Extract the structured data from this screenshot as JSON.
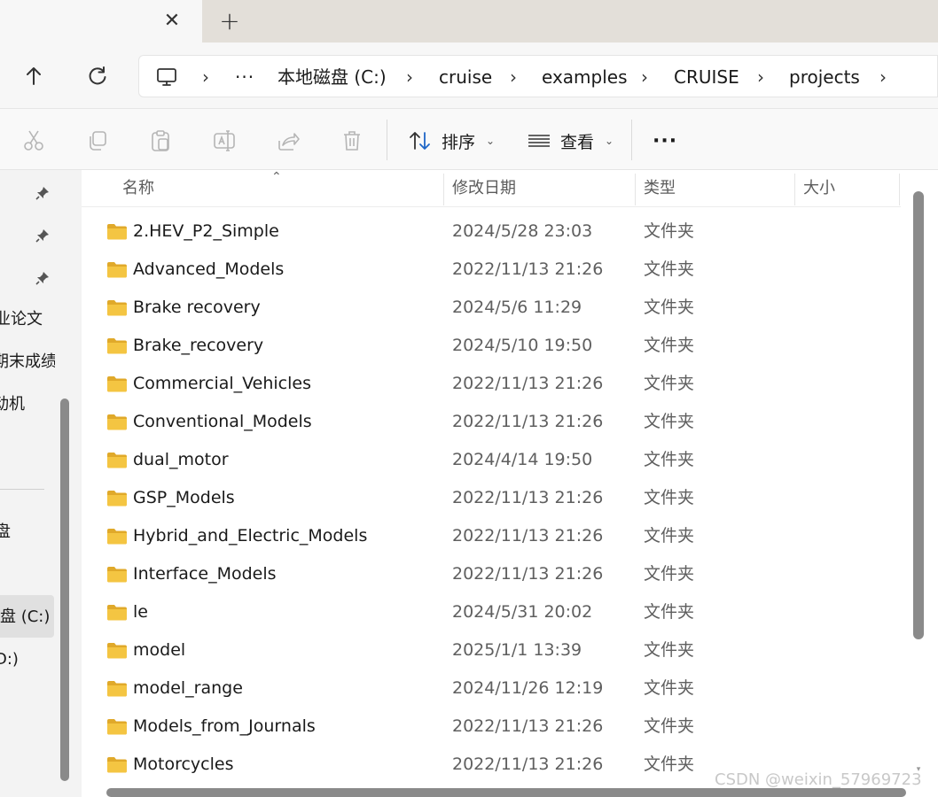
{
  "tab": {
    "close_glyph": "✕",
    "new_glyph": "+"
  },
  "nav": {
    "up_icon": "up-arrow-icon",
    "refresh_icon": "refresh-icon"
  },
  "address": {
    "more": "···",
    "crumbs": [
      "本地磁盘 (C:)",
      "cruise",
      "examples",
      "CRUISE",
      "projects"
    ],
    "separator": "›"
  },
  "toolbar": {
    "sort_label": "排序",
    "view_label": "查看",
    "more": "···"
  },
  "sidebar": {
    "items": [
      "业论文",
      "期末成绩",
      "动机",
      "盘",
      "盘 (C:)",
      "D:)"
    ]
  },
  "columns": {
    "name": "名称",
    "modified": "修改日期",
    "type": "类型",
    "size": "大小"
  },
  "files": [
    {
      "name": "2.HEV_P2_Simple",
      "date": "2024/5/28 23:03",
      "type": "文件夹"
    },
    {
      "name": "Advanced_Models",
      "date": "2022/11/13 21:26",
      "type": "文件夹"
    },
    {
      "name": "Brake recovery",
      "date": "2024/5/6 11:29",
      "type": "文件夹"
    },
    {
      "name": "Brake_recovery",
      "date": "2024/5/10 19:50",
      "type": "文件夹"
    },
    {
      "name": "Commercial_Vehicles",
      "date": "2022/11/13 21:26",
      "type": "文件夹"
    },
    {
      "name": "Conventional_Models",
      "date": "2022/11/13 21:26",
      "type": "文件夹"
    },
    {
      "name": "dual_motor",
      "date": "2024/4/14 19:50",
      "type": "文件夹"
    },
    {
      "name": "GSP_Models",
      "date": "2022/11/13 21:26",
      "type": "文件夹"
    },
    {
      "name": "Hybrid_and_Electric_Models",
      "date": "2022/11/13 21:26",
      "type": "文件夹"
    },
    {
      "name": "Interface_Models",
      "date": "2022/11/13 21:26",
      "type": "文件夹"
    },
    {
      "name": "le",
      "date": "2024/5/31 20:02",
      "type": "文件夹"
    },
    {
      "name": "model",
      "date": "2025/1/1 13:39",
      "type": "文件夹"
    },
    {
      "name": "model_range",
      "date": "2024/11/26 12:19",
      "type": "文件夹"
    },
    {
      "name": "Models_from_Journals",
      "date": "2022/11/13 21:26",
      "type": "文件夹"
    },
    {
      "name": "Motorcycles",
      "date": "2022/11/13 21:26",
      "type": "文件夹"
    }
  ],
  "watermark": "CSDN @weixin_57969723",
  "colors": {
    "folder": "#f4c542",
    "folder_dark": "#e0a92a",
    "selected": "#e0e0e0"
  }
}
